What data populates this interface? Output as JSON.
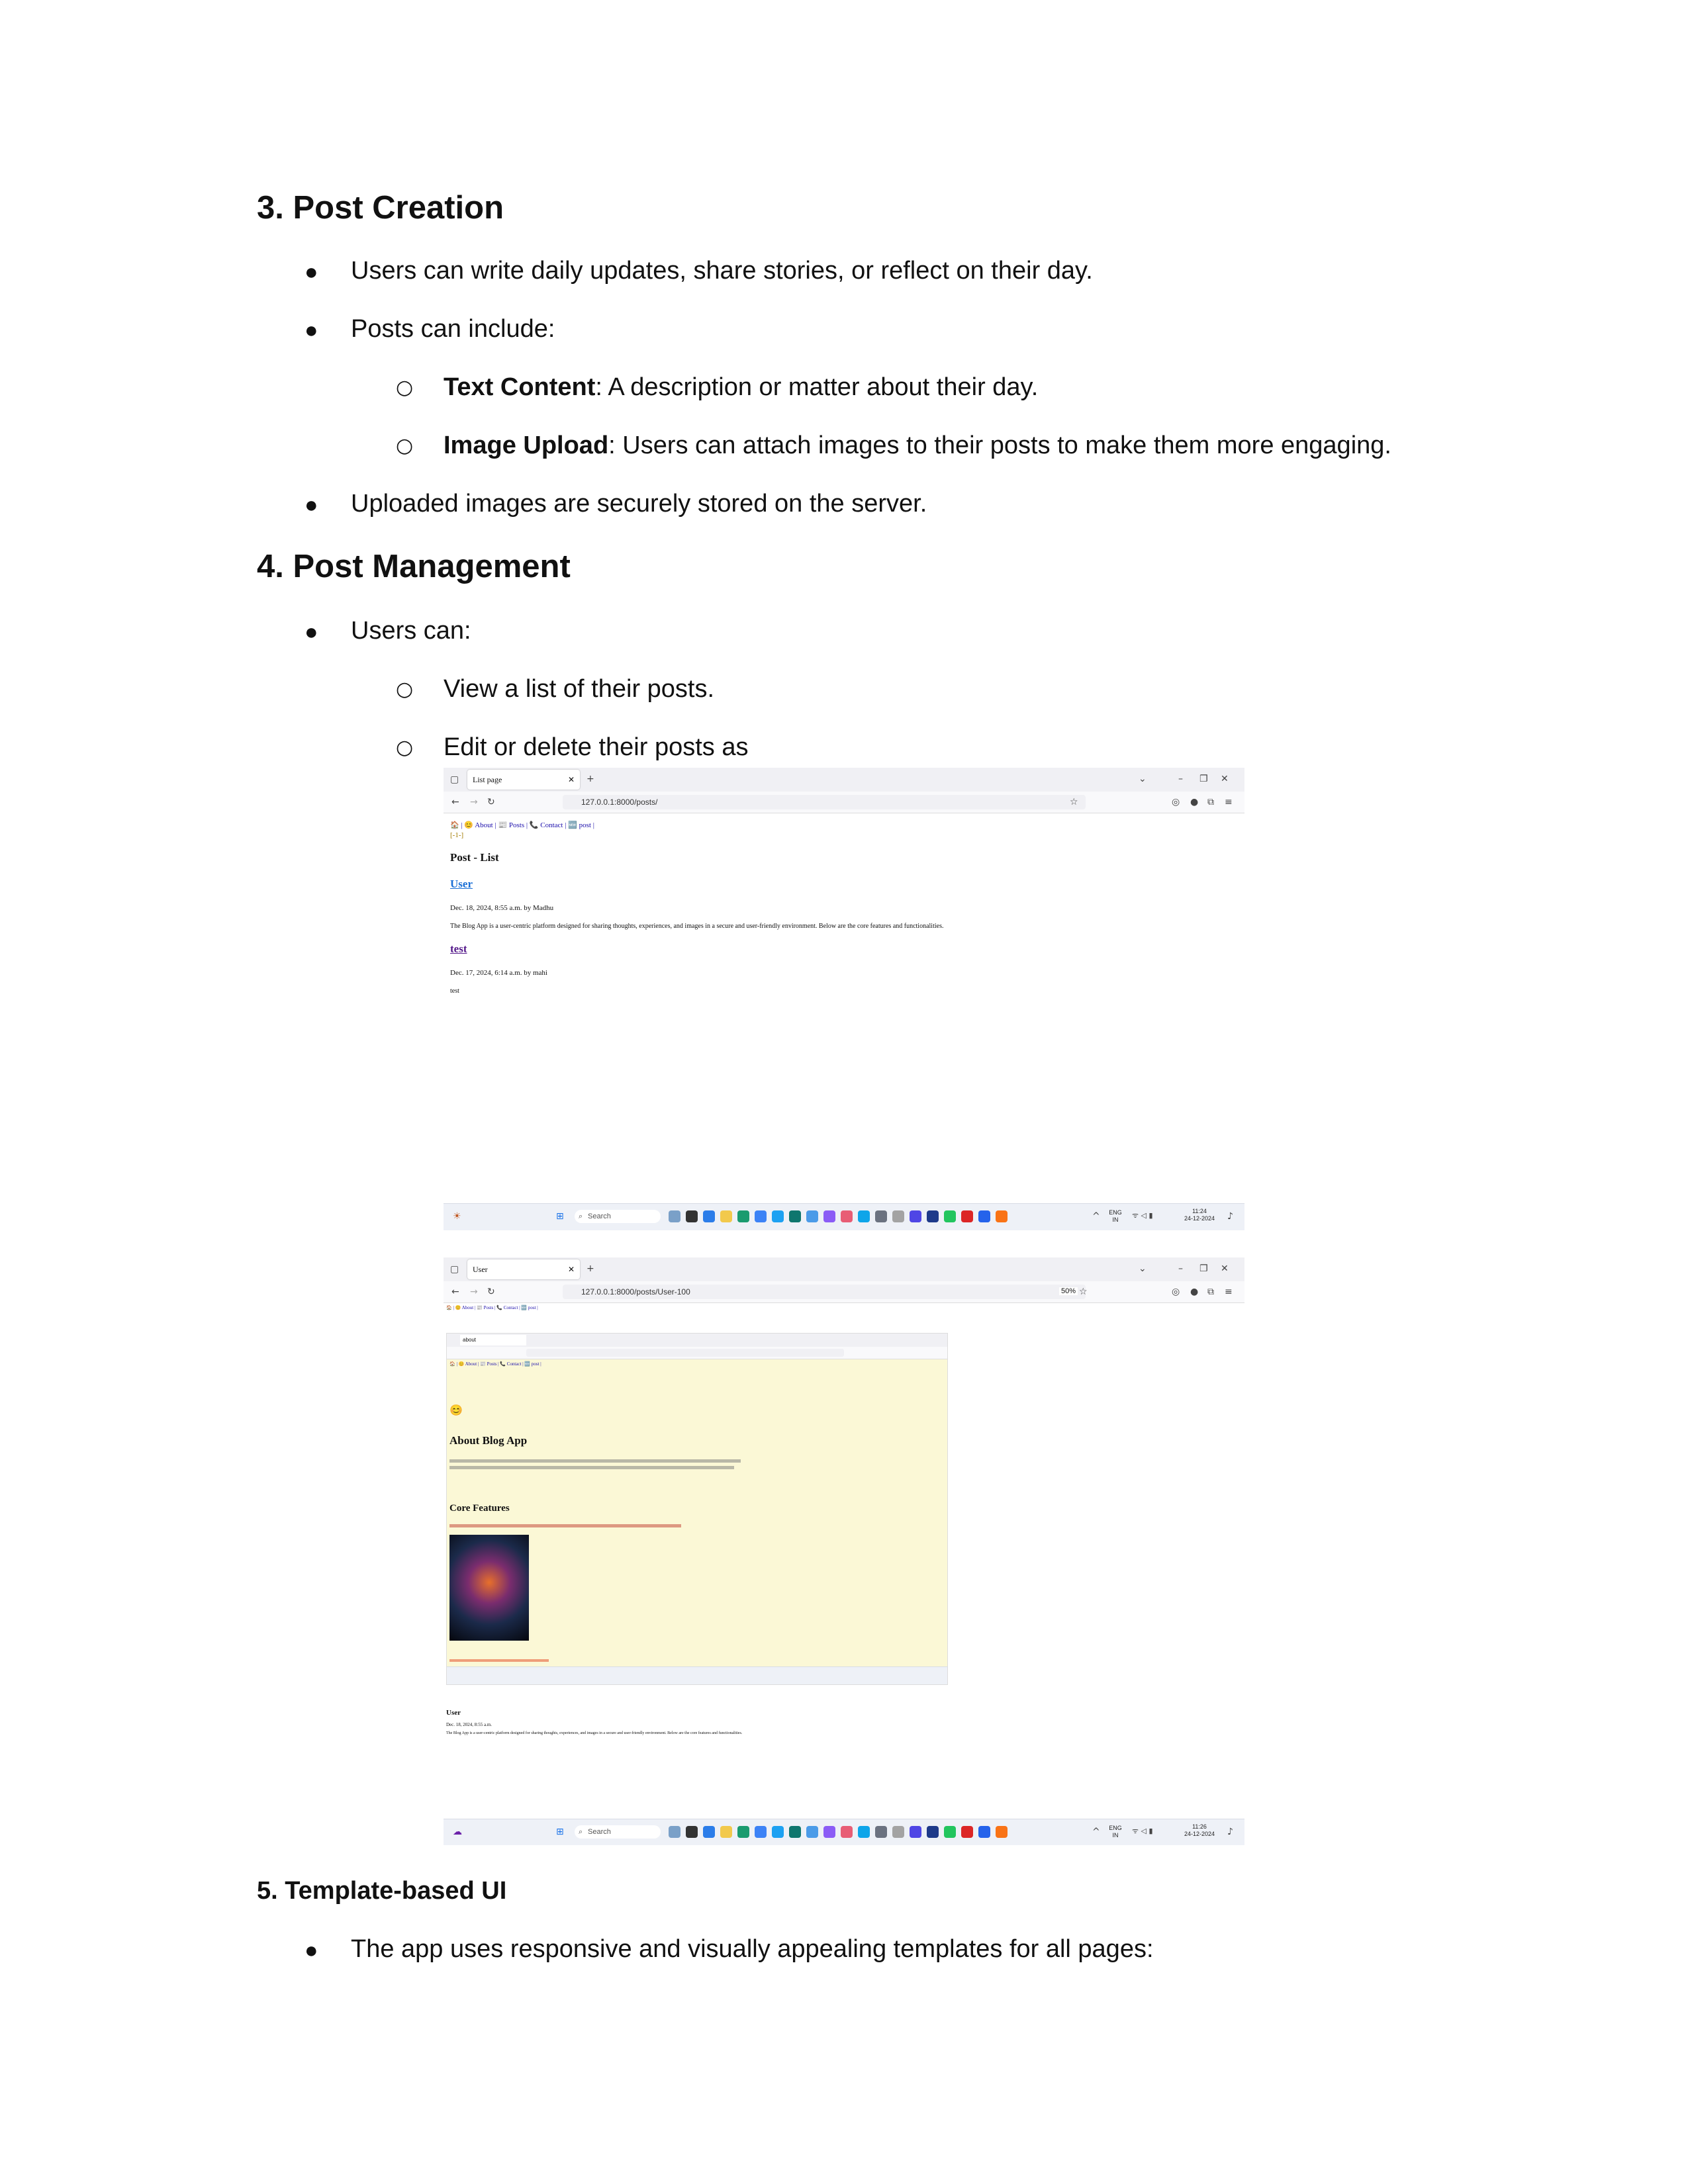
{
  "sections": {
    "post_creation": {
      "heading": "3. Post Creation",
      "bullet1": "Users can write daily updates, share stories, or reflect on their day.",
      "bullet2": "Posts can include:",
      "sub1_label": "Text Content",
      "sub1_text": ": A description or matter about their day.",
      "sub2_label": "Image Upload",
      "sub2_text": ": Users can attach images to their posts to make them more engaging.",
      "bullet3": "Uploaded images are securely stored on the server."
    },
    "post_management": {
      "heading": "4. Post Management",
      "bullet1": "Users can:",
      "sub1": "View a list of their posts.",
      "sub2": "Edit or delete their posts as"
    },
    "template_ui": {
      "heading": "5. Template-based UI",
      "bullet1": "The app uses responsive and visually appealing templates for all pages:"
    }
  },
  "screenshot1": {
    "tab_title": "List page",
    "url": "127.0.0.1:8000/posts/",
    "nav": "🏠 | 😊 About | 📰 Posts | 📞 Contact | 🆕 post |",
    "nav2": "[-1-]",
    "page_heading": "Post - List",
    "post1_title": "User",
    "post1_meta": "Dec. 18, 2024, 8:55 a.m. by Madhu",
    "post1_body": "The Blog App is a user-centric platform designed for sharing thoughts, experiences, and images in a secure and user-friendly environment. Below are the core features and functionalities.",
    "post2_title": "test",
    "post2_meta": "Dec. 17, 2024, 6:14 a.m. by mahi",
    "post2_body": "test",
    "taskbar_search": "Search",
    "taskbar_lang": "ENG\nIN",
    "taskbar_time": "11:24",
    "taskbar_date": "24-12-2024"
  },
  "screenshot2": {
    "tab_title": "User",
    "url": "127.0.0.1:8000/posts/User-100",
    "zoom": "50%",
    "inner_tab_title": "about",
    "inner_heading": "About Blog App",
    "inner_section": "Core Features",
    "post_title": "User",
    "post_meta": "Dec. 18, 2024, 8:55 a.m.",
    "taskbar_search": "Search",
    "taskbar_lang": "ENG\nIN",
    "taskbar_time": "11:26",
    "taskbar_date": "24-12-2024"
  },
  "colors": {
    "text": "#111111",
    "link": "#1a0dab",
    "visited": "#551a8b",
    "about_bg": "#fbf8d6",
    "taskbar": "#eef1f7"
  }
}
